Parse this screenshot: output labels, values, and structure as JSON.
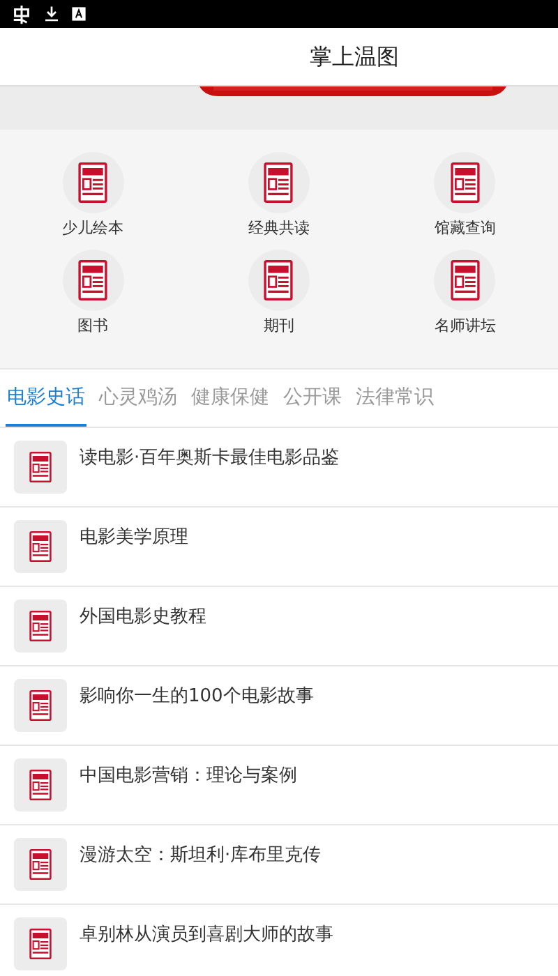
{
  "header": {
    "title": "掌上温图"
  },
  "shortcuts": [
    {
      "label": "少儿绘本"
    },
    {
      "label": "经典共读"
    },
    {
      "label": "馆藏查询"
    },
    {
      "label": "图书"
    },
    {
      "label": "期刊"
    },
    {
      "label": "名师讲坛"
    }
  ],
  "tabs": [
    {
      "label": "电影史话",
      "selected": true
    },
    {
      "label": "心灵鸡汤",
      "selected": false
    },
    {
      "label": "健康保健",
      "selected": false
    },
    {
      "label": "公开课",
      "selected": false
    },
    {
      "label": "法律常识",
      "selected": false
    }
  ],
  "articles": [
    {
      "title": "读电影·百年奥斯卡最佳电影品鉴"
    },
    {
      "title": "电影美学原理"
    },
    {
      "title": "外国电影史教程"
    },
    {
      "title": "影响你一生的100个电影故事"
    },
    {
      "title": "中国电影营销：理论与案例"
    },
    {
      "title": "漫游太空：斯坦利·库布里克传"
    },
    {
      "title": "卓别林从演员到喜剧大师的故事"
    }
  ]
}
